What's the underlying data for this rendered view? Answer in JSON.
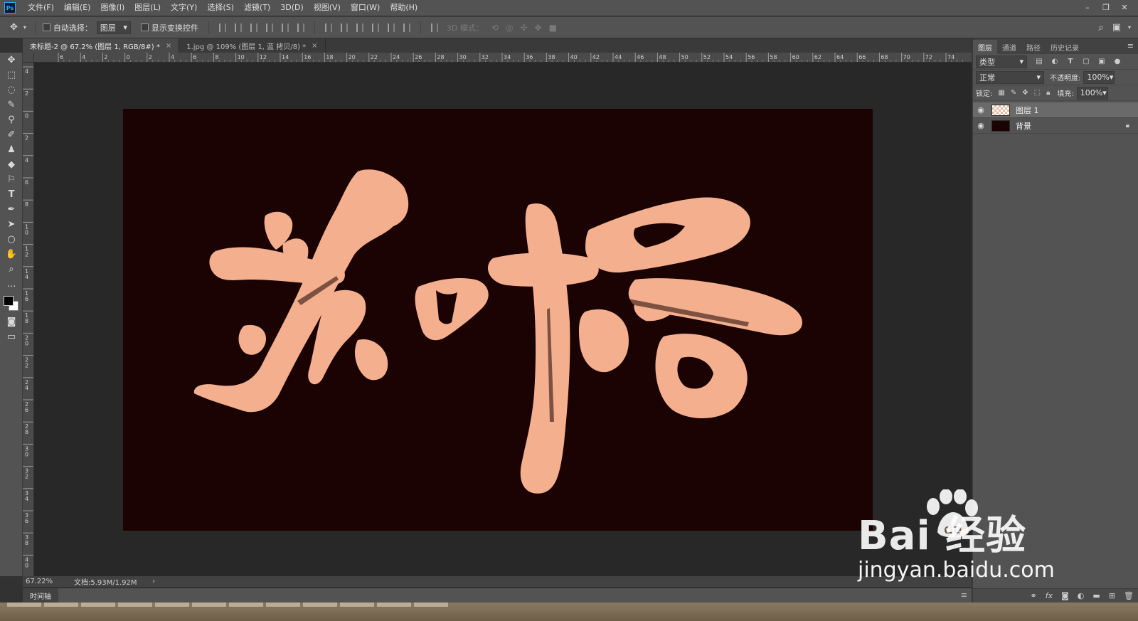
{
  "app": {
    "logo": "Ps"
  },
  "menu": [
    "文件(F)",
    "编辑(E)",
    "图像(I)",
    "图层(L)",
    "文字(Y)",
    "选择(S)",
    "滤镜(T)",
    "3D(D)",
    "视图(V)",
    "窗口(W)",
    "帮助(H)"
  ],
  "options": {
    "auto_select_label": "自动选择：",
    "auto_select_value": "图层",
    "show_transform_label": "显示变换控件",
    "mode3d_label": "3D 模式："
  },
  "tabs": [
    {
      "label": "未标题-2 @ 67.2% (图层 1, RGB/8#) *",
      "close": "×"
    },
    {
      "label": "1.jpg @ 109% (图层 1, 蓝 拷贝/8) *",
      "close": "×"
    }
  ],
  "ruler": {
    "top": [
      "6",
      "4",
      "2",
      "0",
      "2",
      "4",
      "6",
      "8",
      "10",
      "12",
      "14",
      "16",
      "18",
      "20",
      "22",
      "24",
      "26",
      "28",
      "30",
      "32",
      "34",
      "36",
      "38",
      "40",
      "42",
      "44",
      "46",
      "48",
      "50",
      "52",
      "54",
      "56",
      "58",
      "60",
      "62",
      "64",
      "66",
      "68",
      "70",
      "72",
      "74"
    ],
    "left": [
      "4",
      "2",
      "0",
      "2",
      "4",
      "6",
      "8",
      "1 0",
      "1 2",
      "1 4",
      "1 6",
      "1 8",
      "2 0",
      "2 2",
      "2 4",
      "2 6",
      "2 8",
      "3 0",
      "3 2",
      "3 4",
      "3 6",
      "3 8",
      "4 0"
    ]
  },
  "status": {
    "zoom": "67.22%",
    "doc": "文档:5.93M/1.92M",
    "arrow": "›"
  },
  "timeline": {
    "label": "时间轴"
  },
  "panel": {
    "tabs": [
      "图层",
      "通道",
      "路径",
      "历史记录"
    ],
    "filter_value": "类型",
    "blend_mode": "正常",
    "opacity_label": "不透明度:",
    "opacity_value": "100%",
    "lock_label": "锁定:",
    "fill_label": "填充:",
    "fill_value": "100%",
    "layers": [
      {
        "name": "图层 1",
        "active": true
      },
      {
        "name": "背景",
        "active": false
      }
    ]
  },
  "watermark": {
    "brand": "Bai  经验",
    "url": "jingyan.baidu.com"
  },
  "colors": {
    "canvas_bg": "#1c0303",
    "calligraphy": "#f4b08e"
  }
}
